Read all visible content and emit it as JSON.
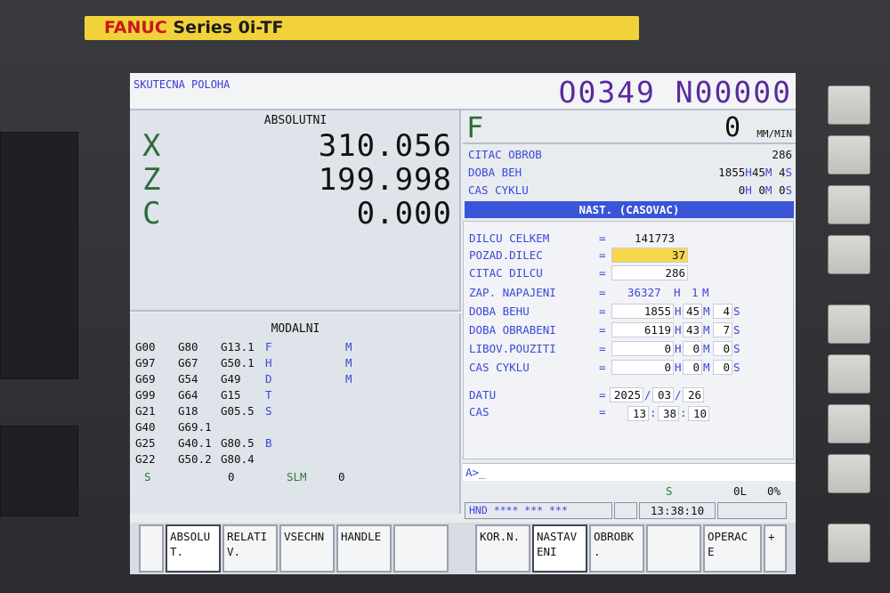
{
  "machine": {
    "brand": "FANUC",
    "series": "Series 0i-TF"
  },
  "header": {
    "title": "SKUTECNA POLOHA",
    "program": "O0349 N00000"
  },
  "position": {
    "heading": "ABSOLUTNI",
    "axes": [
      {
        "label": "X",
        "value": "310.056"
      },
      {
        "label": "Z",
        "value": "199.998"
      },
      {
        "label": "C",
        "value": "0.000"
      }
    ]
  },
  "modal": {
    "heading": "MODALNI",
    "rows": [
      {
        "c1": "G00",
        "c2": "G80",
        "c3": "G13.1",
        "c4": "F",
        "c5": "M"
      },
      {
        "c1": "G97",
        "c2": "G67",
        "c3": "G50.1",
        "c4": "H",
        "c5": "M"
      },
      {
        "c1": "G69",
        "c2": "G54",
        "c3": "G49",
        "c4": "D",
        "c5": "M"
      },
      {
        "c1": "G99",
        "c2": "G64",
        "c3": "G15",
        "c4": "T",
        "c5": ""
      },
      {
        "c1": "G21",
        "c2": "G18",
        "c3": "G05.5",
        "c4": "S",
        "c5": ""
      },
      {
        "c1": "G40",
        "c2": "G69.1",
        "c3": "",
        "c4": "",
        "c5": ""
      },
      {
        "c1": "G25",
        "c2": "G40.1",
        "c3": "G80.5",
        "c4": "B",
        "c5": ""
      },
      {
        "c1": "G22",
        "c2": "G50.2",
        "c3": "G80.4",
        "c4": "",
        "c5": ""
      }
    ],
    "s_label": "S",
    "s_value": "0",
    "slm_label": "SLM",
    "slm_value": "0"
  },
  "feed": {
    "label": "F",
    "value": "0",
    "unit": "MM/MIN"
  },
  "info": {
    "parts_count_label": "CITAC OBROB",
    "parts_count_value": "286",
    "run_time_label": "DOBA BEH",
    "run_time_h": "1855",
    "run_time_m": "45",
    "run_time_s": "4",
    "cycle_time_label": "CAS CYKLU",
    "cycle_time_h": "0",
    "cycle_time_m": "0",
    "cycle_time_s": "0"
  },
  "timer": {
    "title": "NAST. (CASOVAC)",
    "total_parts_label": "DILCU CELKEM",
    "total_parts_value": "141773",
    "required_parts_label": "POZAD.DILEC",
    "required_parts_value": "37",
    "part_count_label": "CITAC DILCU",
    "part_count_value": "286",
    "power_on_label": "ZAP. NAPAJENI",
    "power_on_h": "36327",
    "power_on_m": "1",
    "operating_label": "DOBA BEHU",
    "operating_h": "1855",
    "operating_m": "45",
    "operating_s": "4",
    "cutting_label": "DOBA OBRABENI",
    "cutting_h": "6119",
    "cutting_m": "43",
    "cutting_s": "7",
    "free_label": "LIBOV.POUZITI",
    "free_h": "0",
    "free_m": "0",
    "free_s": "0",
    "cycle_label": "CAS CYKLU",
    "cycle_h": "0",
    "cycle_m": "0",
    "cycle_s": "0",
    "date_label": "DATU",
    "date_y": "2025",
    "date_m": "03",
    "date_d": "26",
    "time_label": "CAS",
    "time_h": "13",
    "time_m": "38",
    "time_s": "10",
    "eq": "=",
    "unit_h": "H",
    "unit_m": "M",
    "unit_s": "S",
    "sep_date": "/",
    "sep_time": ":"
  },
  "status": {
    "prompt": "A>_",
    "spindle_label": "S",
    "load": "0L",
    "percent": "0%",
    "mode": "HND  **** *** ***",
    "clock": "13:38:10"
  },
  "softkeys": [
    {
      "label": "",
      "selected": false
    },
    {
      "label": "ABSOLU\nT.",
      "selected": true
    },
    {
      "label": "RELATI\nV.",
      "selected": false
    },
    {
      "label": "VSECHN",
      "selected": false
    },
    {
      "label": "HANDLE",
      "selected": false
    },
    {
      "label": "",
      "selected": false
    },
    {
      "label": "KOR.N.",
      "selected": false
    },
    {
      "label": "NASTAV\nENI",
      "selected": true
    },
    {
      "label": "OBROBK\n.",
      "selected": false
    },
    {
      "label": "",
      "selected": false
    },
    {
      "label": "OPERAC\nE",
      "selected": false
    },
    {
      "label": "+",
      "selected": false
    }
  ]
}
